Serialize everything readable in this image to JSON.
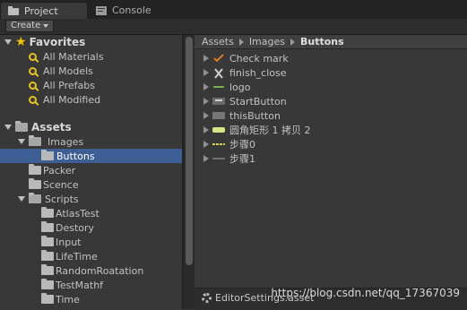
{
  "tabs": [
    {
      "label": "Project",
      "icon": "folder-icon"
    },
    {
      "label": "Console",
      "icon": "console-icon"
    }
  ],
  "toolbar": {
    "create_label": "Create"
  },
  "favorites": {
    "title": "Favorites",
    "items": [
      "All Materials",
      "All Models",
      "All Prefabs",
      "All Modified"
    ]
  },
  "assets_tree": {
    "title": "Assets",
    "images": "Images",
    "buttons": "Buttons",
    "packer": "Packer",
    "scence": "Scence",
    "scripts": "Scripts",
    "script_children": [
      "AtlasTest",
      "Destory",
      "Input",
      "LifeTime",
      "RandomRoatation",
      "TestMathf",
      "Time"
    ]
  },
  "breadcrumb": {
    "parts": [
      "Assets",
      "Images"
    ],
    "current": "Buttons"
  },
  "asset_list": [
    {
      "name": "Check mark",
      "icon": "checkmark-icon"
    },
    {
      "name": "finish_close",
      "icon": "close-icon"
    },
    {
      "name": "logo",
      "icon": "logo-icon"
    },
    {
      "name": "StartButton",
      "icon": "sprite-icon"
    },
    {
      "name": "thisButton",
      "icon": "sprite-icon"
    },
    {
      "name": "圆角矩形 1 拷贝 2",
      "icon": "sprite-icon"
    },
    {
      "name": "步骤0",
      "icon": "sprite-icon"
    },
    {
      "name": "步骤1",
      "icon": "sprite-icon"
    }
  ],
  "footer": {
    "file": "EditorSettings.asset",
    "watermark": "https://blog.csdn.net/qq_17367039"
  },
  "colors": {
    "selection": "#3e5f96",
    "favorites_star": "#f5c400"
  }
}
